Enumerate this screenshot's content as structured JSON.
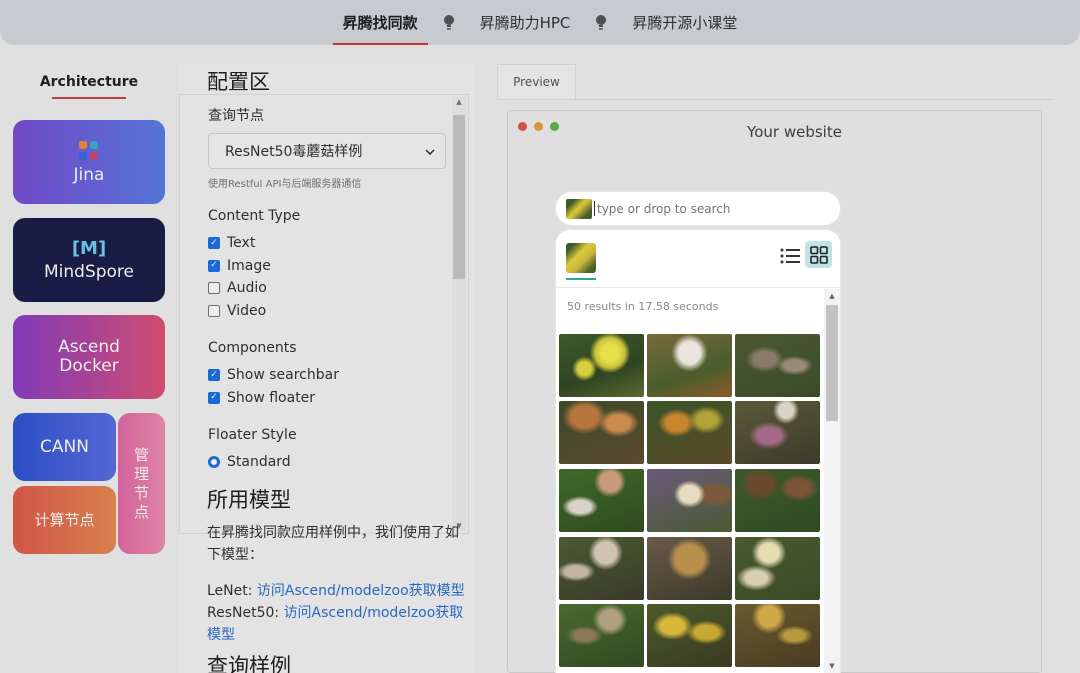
{
  "topnav": {
    "items": [
      {
        "label": "昇腾找同款",
        "active": true
      },
      {
        "label": "昇腾助力HPC",
        "active": false
      },
      {
        "label": "昇腾开源小课堂",
        "active": false
      }
    ]
  },
  "sidebar": {
    "title": "Architecture",
    "tiles": {
      "jina": "Jina",
      "mindspore_logo": "[M]",
      "mindspore": "MindSpore",
      "ascend_line1": "Ascend",
      "ascend_line2": "Docker",
      "cann": "CANN",
      "compute": "计算节点",
      "manage": [
        "管",
        "理",
        "节",
        "点"
      ]
    }
  },
  "config": {
    "title": "配置区",
    "query_node_label": "查询节点",
    "query_node_value": "ResNet50毒蘑菇样例",
    "query_node_hint": "使用Restful API与后端服务器通信",
    "content_type_label": "Content Type",
    "content_types": [
      {
        "label": "Text",
        "checked": true
      },
      {
        "label": "Image",
        "checked": true
      },
      {
        "label": "Audio",
        "checked": false
      },
      {
        "label": "Video",
        "checked": false
      }
    ],
    "components_label": "Components",
    "components": [
      {
        "label": "Show searchbar",
        "checked": true
      },
      {
        "label": "Show floater",
        "checked": true
      }
    ],
    "floater_style_label": "Floater Style",
    "floater_style_value": "Standard"
  },
  "models": {
    "title": "所用模型",
    "description": "在昇腾找同款应用样例中，我们使用了如下模型：",
    "lenet_prefix": "LeNet: ",
    "lenet_link": "访问Ascend/modelzoo获取模型",
    "resnet_prefix": "ResNet50: ",
    "resnet_link": "访问Ascend/modelzoo获取模型",
    "query_examples_title": "查询样例"
  },
  "preview": {
    "tab_label": "Preview",
    "window_title": "Your website",
    "search_placeholder": "type or drop to search",
    "results_count": "50 results in 17.58 seconds"
  },
  "colors": {
    "accent_red": "#d23b3b",
    "link_blue": "#2d6fcf",
    "teal": "#2ea29b",
    "checkbox_blue": "#1a73e8"
  },
  "icons": {
    "nav_separator": "lightbulb-icon",
    "list_view": "list-view-icon",
    "grid_view": "grid-view-icon",
    "select_caret": "chevron-down-icon"
  }
}
